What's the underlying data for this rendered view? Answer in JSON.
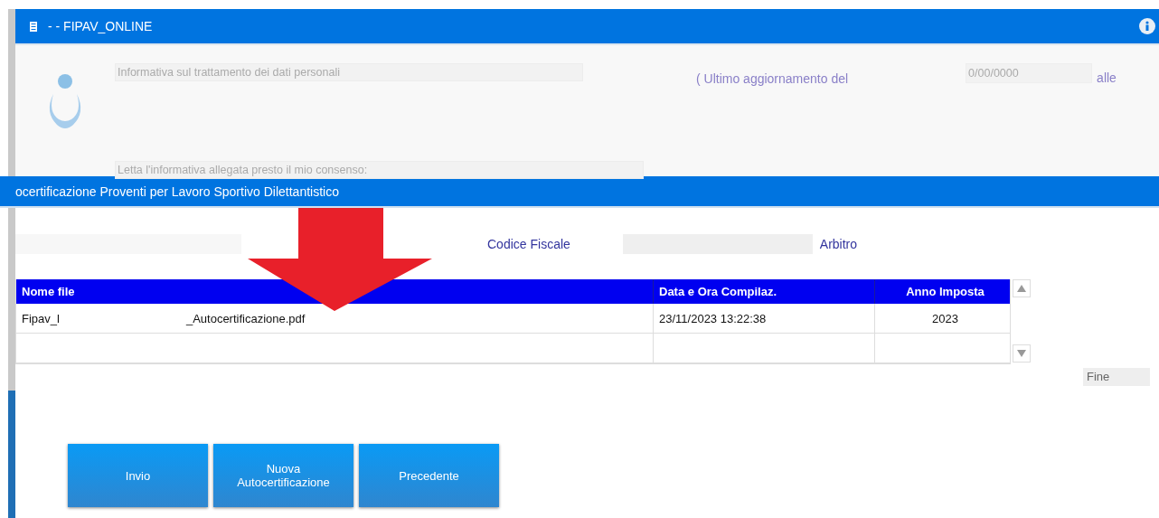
{
  "window": {
    "title": "- - FIPAV_ONLINE"
  },
  "privacy": {
    "notice_field": {
      "value": "Informativa sul trattamento dei dati personali"
    },
    "update_label": "( Ultimo aggiornamento del",
    "update_date_field": {
      "placeholder": "0/00/0000"
    },
    "time_label": "alle",
    "consent_field": {
      "value": "Letta l'informativa allegata presto il mio consenso:"
    }
  },
  "section": {
    "title": "ocertificazione Proventi per Lavoro Sportivo Dilettantistico"
  },
  "form": {
    "codice_fiscale_label": "Codice Fiscale",
    "role_label": "Arbitro"
  },
  "table": {
    "columns": [
      "Nome file",
      "Data e Ora Compilaz.",
      "Anno Imposta"
    ],
    "rows": [
      {
        "file_name": [
          "Fipav_l",
          "_Autocertificazione.pdf"
        ],
        "date": "23/11/2023  13:22:38",
        "year": "2023"
      }
    ]
  },
  "fine_field": {
    "value": "Fine"
  },
  "buttons": [
    "Invio",
    "Nuova Autocertificazione",
    "Precedente"
  ]
}
